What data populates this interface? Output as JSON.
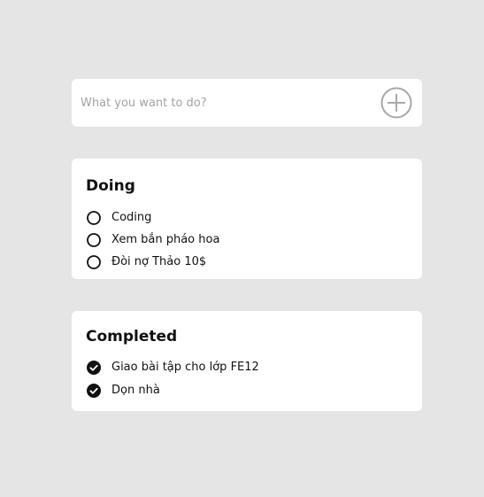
{
  "input": {
    "placeholder": "What you want to do?",
    "value": "",
    "add_icon": "plus-circle-icon"
  },
  "doing": {
    "title": "Doing",
    "icon": "empty-circle-icon",
    "tasks": [
      {
        "label": "Coding"
      },
      {
        "label": "Xem bắn pháo hoa"
      },
      {
        "label": "Đòi nợ Thảo 10$"
      }
    ]
  },
  "completed": {
    "title": "Completed",
    "icon": "check-circle-icon",
    "tasks": [
      {
        "label": "Giao bài tập cho lớp FE12"
      },
      {
        "label": "Dọn nhà"
      }
    ]
  },
  "colors": {
    "background": "#e5e5e5",
    "card": "#ffffff",
    "accent": "#111111",
    "add_icon": "#a8a8a8"
  }
}
